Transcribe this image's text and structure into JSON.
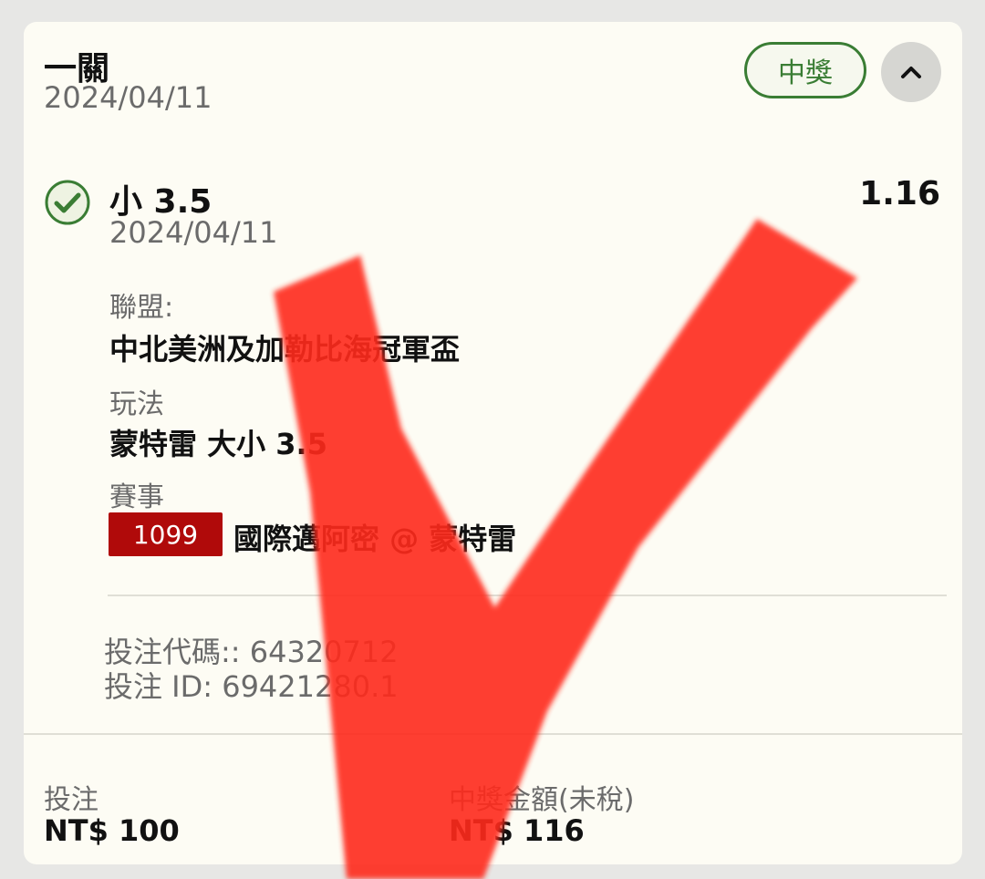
{
  "bet": {
    "type": "一關",
    "date": "2024/04/11",
    "status": "中獎"
  },
  "selection": {
    "name": "小 3.5",
    "odds": "1.16",
    "date": "2024/04/11"
  },
  "details": {
    "league_label": "聯盟:",
    "league_value": "中北美洲及加勒比海冠軍盃",
    "market_label": "玩法",
    "market_value": "蒙特雷 大小 3.5",
    "event_label": "賽事",
    "event_id": "1099",
    "event_name": "國際邁阿密 @ 蒙特雷"
  },
  "codes": {
    "bet_code": "投注代碼:: 64320712",
    "bet_id": "投注 ID: 69421280.1"
  },
  "summary": {
    "stake_label": "投注",
    "stake_value": "NT$ 100",
    "winnings_label": "中獎金額(未稅)",
    "winnings_value": "NT$ 116"
  },
  "colors": {
    "win_green": "#3a7d34",
    "event_badge_red": "#b00a0a",
    "check_mark_overlay": "#ff2a1f"
  },
  "icons": {
    "collapse": "chevron-up-icon",
    "selection_status": "check-circle-icon",
    "overlay": "red-check-mark-icon"
  }
}
